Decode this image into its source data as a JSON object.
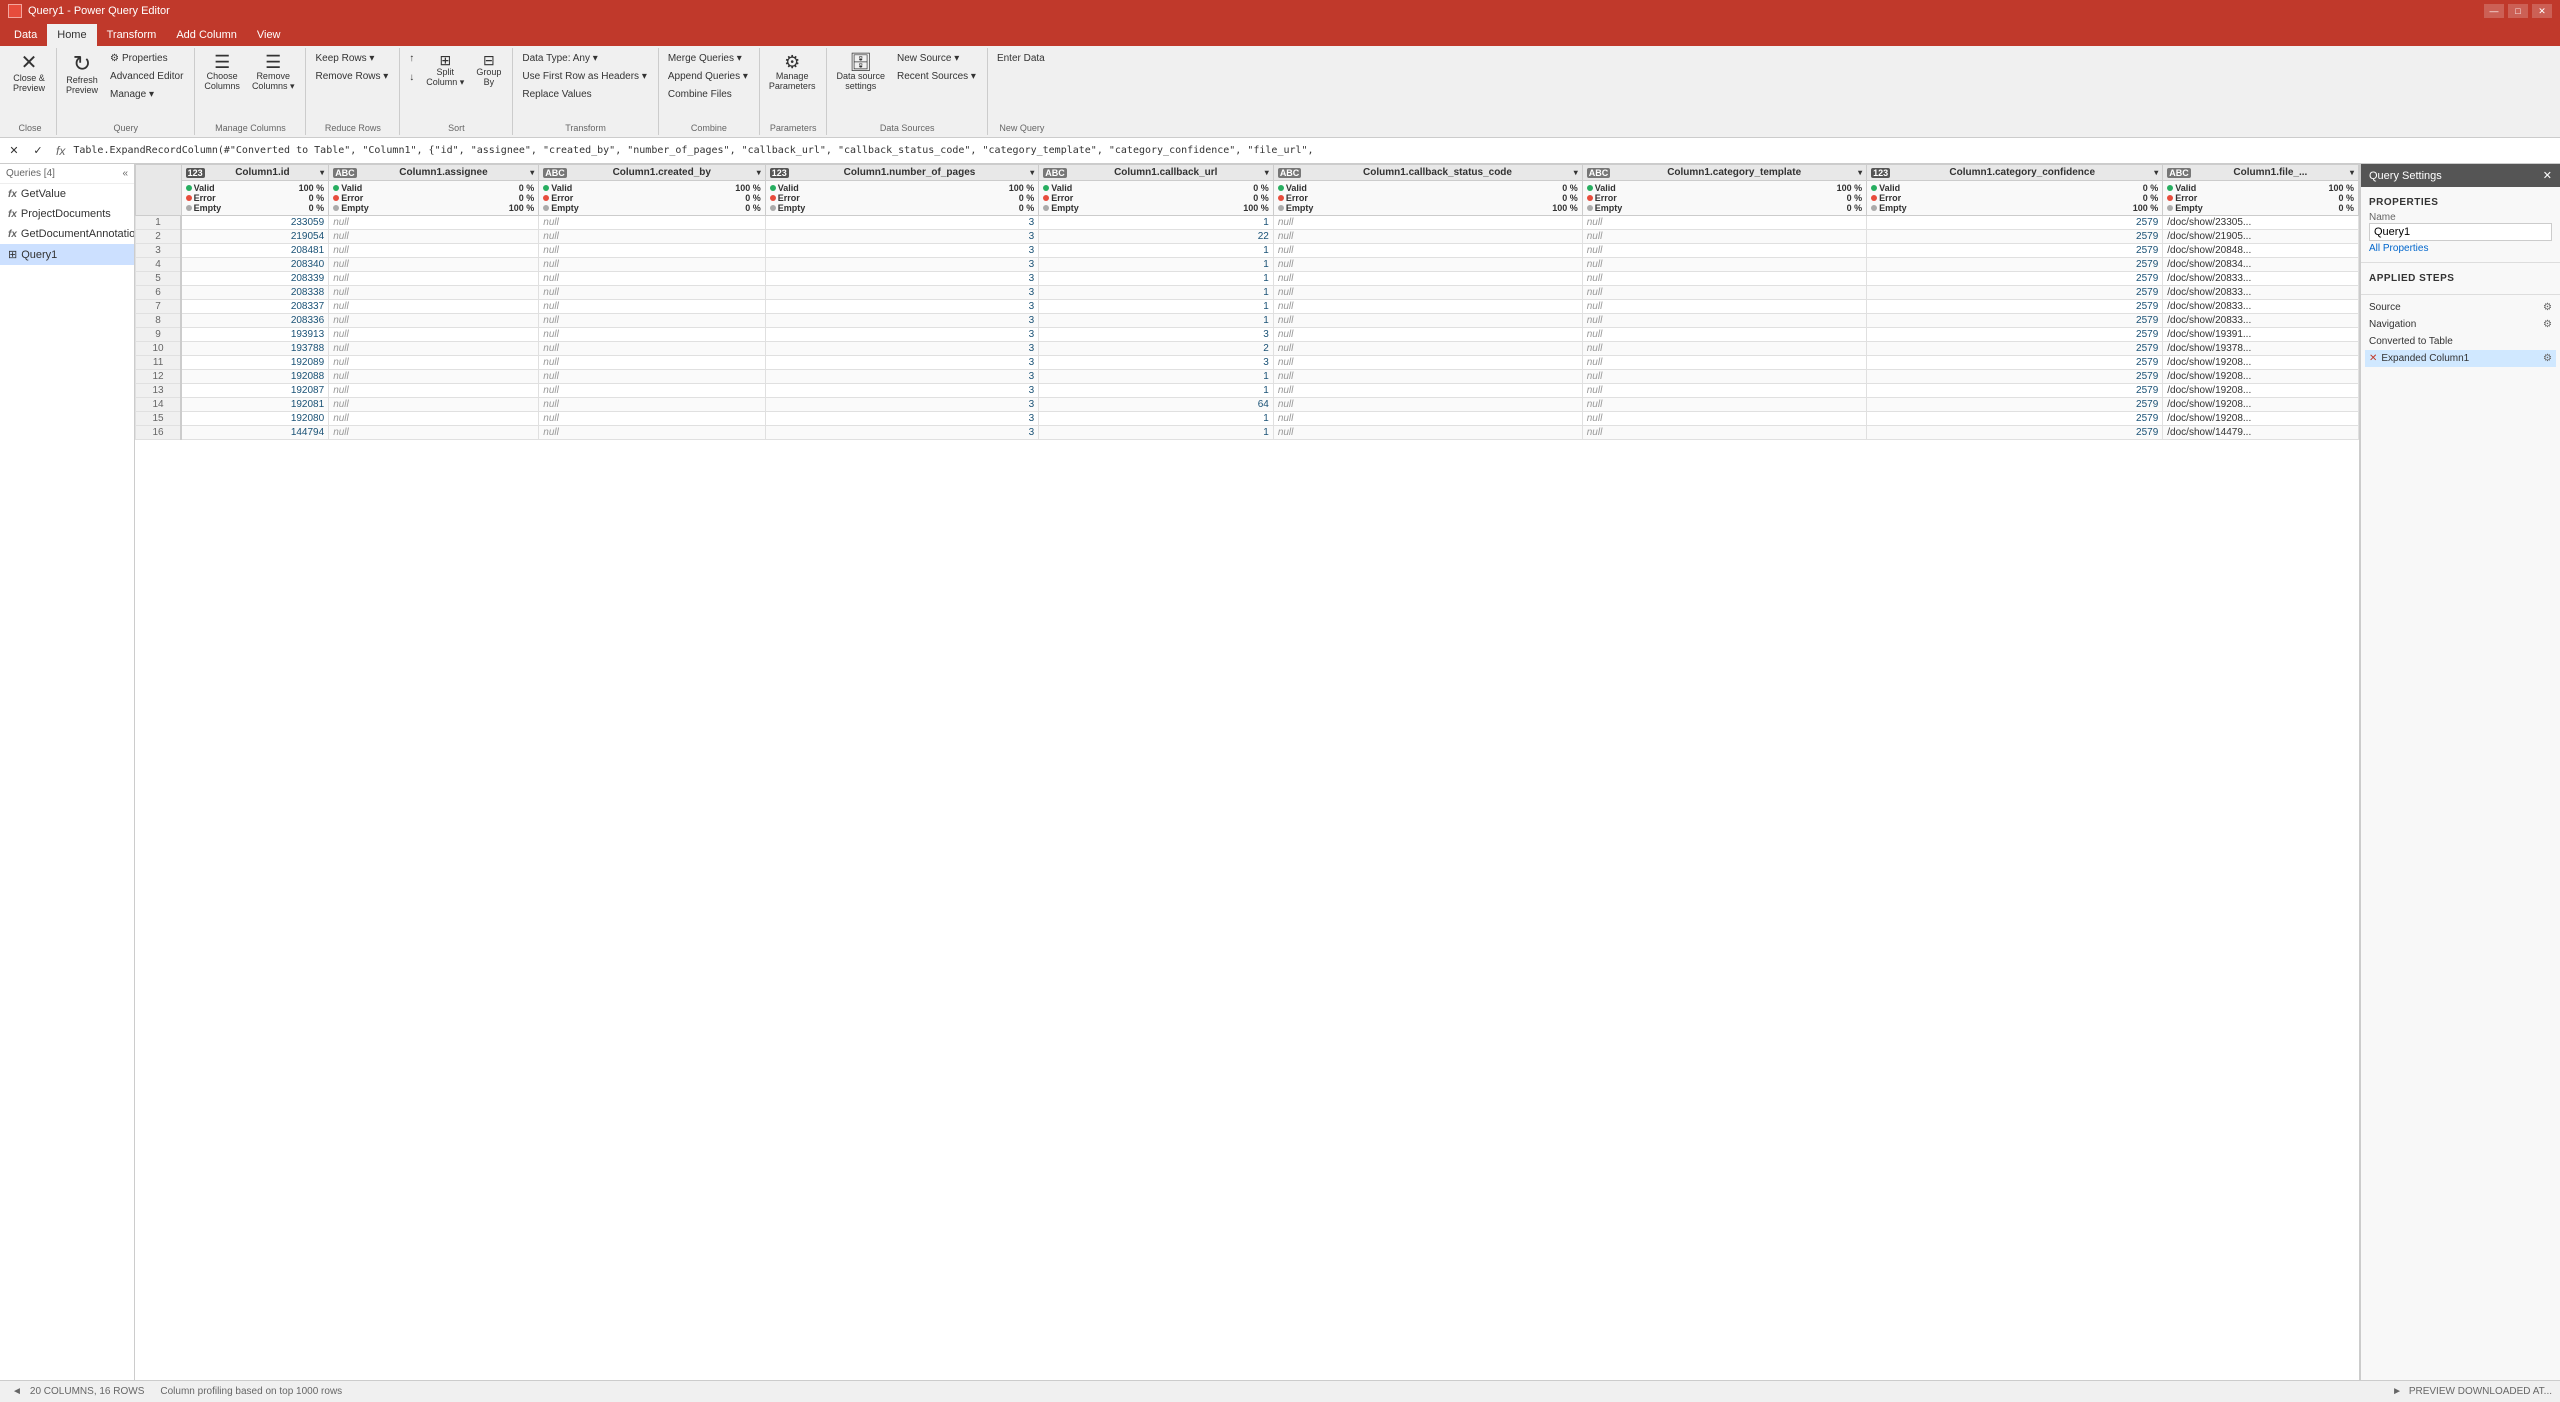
{
  "titlebar": {
    "icon": "⚡",
    "title": "Query1 - Power Query Editor",
    "controls": [
      "—",
      "□",
      "✕"
    ]
  },
  "tabs": [
    {
      "id": "data",
      "label": "Data"
    },
    {
      "id": "home",
      "label": "Home",
      "active": true
    },
    {
      "id": "transform",
      "label": "Transform"
    },
    {
      "id": "add_column",
      "label": "Add Column"
    },
    {
      "id": "view",
      "label": "View"
    }
  ],
  "ribbon": {
    "groups": [
      {
        "label": "Close",
        "items": [
          {
            "type": "big",
            "icon": "✕",
            "label": "Close &\nPreview",
            "name": "close-preview"
          }
        ]
      },
      {
        "label": "Query",
        "items": [
          {
            "type": "big",
            "icon": "↻",
            "label": "Refresh\nPreview",
            "name": "refresh-preview"
          },
          {
            "type": "col",
            "items": [
              {
                "label": "Properties",
                "icon": "⚙",
                "name": "properties"
              },
              {
                "label": "Advanced Editor",
                "name": "advanced-editor"
              },
              {
                "label": "Manage ▾",
                "name": "manage"
              }
            ]
          }
        ]
      },
      {
        "label": "Manage Columns",
        "items": [
          {
            "type": "big",
            "icon": "☰+",
            "label": "Choose\nColumns",
            "name": "choose-columns"
          },
          {
            "type": "big",
            "icon": "☰-",
            "label": "Remove\nColumns ▾",
            "name": "remove-columns"
          }
        ]
      },
      {
        "label": "Reduce Rows",
        "items": [
          {
            "type": "col",
            "items": [
              {
                "label": "Keep\nRows ▾",
                "name": "keep-rows"
              },
              {
                "label": "Remove\nRows ▾",
                "name": "remove-rows"
              }
            ]
          }
        ]
      },
      {
        "label": "Sort",
        "items": [
          {
            "type": "col",
            "items": [
              {
                "label": "↑",
                "name": "sort-asc"
              },
              {
                "label": "↓",
                "name": "sort-desc"
              },
              {
                "label": "Split\nColumn ▾",
                "name": "split-column"
              },
              {
                "label": "Group\nBy",
                "name": "group-by"
              }
            ]
          }
        ]
      },
      {
        "label": "Transform",
        "items": [
          {
            "type": "col",
            "items": [
              {
                "label": "Data Type: Any ▾",
                "name": "data-type"
              },
              {
                "label": "Use First Row as Headers ▾",
                "name": "use-first-row"
              },
              {
                "label": "Replace Values",
                "name": "replace-values"
              }
            ]
          }
        ]
      },
      {
        "label": "Combine",
        "items": [
          {
            "type": "col",
            "items": [
              {
                "label": "Merge Queries ▾",
                "name": "merge-queries"
              },
              {
                "label": "Append Queries ▾",
                "name": "append-queries"
              },
              {
                "label": "Combine Files",
                "name": "combine-files"
              }
            ]
          }
        ]
      },
      {
        "label": "Parameters",
        "items": [
          {
            "type": "big",
            "icon": "⚙",
            "label": "Manage\nParameters",
            "name": "manage-parameters"
          }
        ]
      },
      {
        "label": "Data Sources",
        "items": [
          {
            "type": "big",
            "icon": "🗄",
            "label": "Data source\nsettings",
            "name": "data-source-settings"
          },
          {
            "type": "col",
            "items": [
              {
                "label": "▲ New Source ▾",
                "name": "new-source"
              },
              {
                "label": "Recent Sources ▾",
                "name": "recent-sources"
              }
            ]
          }
        ]
      },
      {
        "label": "New Query",
        "items": [
          {
            "type": "col",
            "items": [
              {
                "label": "Enter Data",
                "name": "enter-data"
              }
            ]
          }
        ]
      }
    ]
  },
  "formula_bar": {
    "cancel": "✕",
    "confirm": "✓",
    "fx": "fx",
    "formula": "Table.ExpandRecordColumn(#\"Converted to Table\", \"Column1\", {\"id\", \"assignee\", \"created_by\", \"number_of_pages\", \"callback_url\", \"callback_status_code\", \"category_template\", \"category_confidence\", \"file_url\","
  },
  "queries": {
    "header": "Queries [4]",
    "items": [
      {
        "name": "GetValue",
        "type": "fx",
        "icon": "fx"
      },
      {
        "name": "ProjectDocuments",
        "type": "fx",
        "icon": "fx"
      },
      {
        "name": "GetDocumentAnnotations",
        "type": "fx",
        "icon": "fx"
      },
      {
        "name": "Query1",
        "type": "query",
        "icon": "⊞",
        "selected": true
      }
    ]
  },
  "columns": [
    {
      "type": "123",
      "name": "Column1.id",
      "valid": "Valid",
      "valid_pct": "100 %",
      "error": "Error",
      "error_pct": "0 %",
      "empty": "Empty",
      "empty_pct": "0 %"
    },
    {
      "type": "ABC",
      "name": "Column1.assignee",
      "valid": "Valid",
      "valid_pct": "0 %",
      "error": "Error",
      "error_pct": "0 %",
      "empty": "Empty",
      "empty_pct": "100 %"
    },
    {
      "type": "ABC",
      "name": "Column1.created_by",
      "valid": "Valid",
      "valid_pct": "100 %",
      "error": "Error",
      "error_pct": "0 %",
      "empty": "Empty",
      "empty_pct": "0 %"
    },
    {
      "type": "123",
      "name": "Column1.number_of_pages",
      "valid": "Valid",
      "valid_pct": "100 %",
      "error": "Error",
      "error_pct": "0 %",
      "empty": "Empty",
      "empty_pct": "0 %"
    },
    {
      "type": "ABC",
      "name": "Column1.callback_url",
      "valid": "Valid",
      "valid_pct": "0 %",
      "error": "Error",
      "error_pct": "0 %",
      "empty": "Empty",
      "empty_pct": "100 %"
    },
    {
      "type": "ABC",
      "name": "Column1.callback_status_code",
      "valid": "Valid",
      "valid_pct": "0 %",
      "error": "Error",
      "error_pct": "0 %",
      "empty": "Empty",
      "empty_pct": "100 %"
    },
    {
      "type": "ABC",
      "name": "Column1.category_template",
      "valid": "Valid",
      "valid_pct": "100 %",
      "error": "Error",
      "error_pct": "0 %",
      "empty": "Empty",
      "empty_pct": "0 %"
    },
    {
      "type": "123",
      "name": "Column1.category_confidence",
      "valid": "Valid",
      "valid_pct": "0 %",
      "error": "Error",
      "error_pct": "0 %",
      "empty": "Empty",
      "empty_pct": "100 %"
    },
    {
      "type": "ABC",
      "name": "Column1.file_url (trunc)",
      "valid": "Valid",
      "valid_pct": "100 %",
      "error": "Error",
      "error_pct": "0 %",
      "empty": "Empty",
      "empty_pct": "0 %"
    }
  ],
  "rows": [
    [
      1,
      233059,
      "null",
      "null",
      3,
      1,
      "null",
      "null",
      2579,
      "/doc/show/23305..."
    ],
    [
      2,
      219054,
      "null",
      "null",
      3,
      22,
      "null",
      "null",
      2579,
      "/doc/show/21905..."
    ],
    [
      3,
      208481,
      "null",
      "null",
      3,
      1,
      "null",
      "null",
      2579,
      "/doc/show/20848..."
    ],
    [
      4,
      208340,
      "null",
      "null",
      3,
      1,
      "null",
      "null",
      2579,
      "/doc/show/20834..."
    ],
    [
      5,
      208339,
      "null",
      "null",
      3,
      1,
      "null",
      "null",
      2579,
      "/doc/show/20833..."
    ],
    [
      6,
      208338,
      "null",
      "null",
      3,
      1,
      "null",
      "null",
      2579,
      "/doc/show/20833..."
    ],
    [
      7,
      208337,
      "null",
      "null",
      3,
      1,
      "null",
      "null",
      2579,
      "/doc/show/20833..."
    ],
    [
      8,
      208336,
      "null",
      "null",
      3,
      1,
      "null",
      "null",
      2579,
      "/doc/show/20833..."
    ],
    [
      9,
      193913,
      "null",
      "null",
      3,
      3,
      "null",
      "null",
      2579,
      "/doc/show/19391..."
    ],
    [
      10,
      193788,
      "null",
      "null",
      3,
      2,
      "null",
      "null",
      2579,
      "/doc/show/19378..."
    ],
    [
      11,
      192089,
      "null",
      "null",
      3,
      3,
      "null",
      "null",
      2579,
      "/doc/show/19208..."
    ],
    [
      12,
      192088,
      "null",
      "null",
      3,
      1,
      "null",
      "null",
      2579,
      "/doc/show/19208..."
    ],
    [
      13,
      192087,
      "null",
      "null",
      3,
      1,
      "null",
      "null",
      2579,
      "/doc/show/19208..."
    ],
    [
      14,
      192081,
      "null",
      "null",
      3,
      64,
      "null",
      "null",
      2579,
      "/doc/show/19208..."
    ],
    [
      15,
      192080,
      "null",
      "null",
      3,
      1,
      "null",
      "null",
      2579,
      "/doc/show/19208..."
    ],
    [
      16,
      144794,
      "null",
      "null",
      3,
      1,
      "null",
      "null",
      2579,
      "/doc/show/14479..."
    ]
  ],
  "query_settings": {
    "title": "Query Settings",
    "close": "✕",
    "properties_label": "PROPERTIES",
    "name_label": "Name",
    "name_value": "Query1",
    "all_properties": "All Properties",
    "applied_steps_label": "APPLIED STEPS",
    "steps": [
      {
        "name": "Source",
        "active": false,
        "has_gear": true
      },
      {
        "name": "Navigation",
        "active": false,
        "has_gear": true
      },
      {
        "name": "Converted to Table",
        "active": false,
        "has_gear": false
      },
      {
        "name": "Expanded Column1",
        "active": true,
        "has_gear": true
      }
    ]
  },
  "status": {
    "columns": "20 COLUMNS, 16 ROWS",
    "profiling": "Column profiling based on top 1000 rows",
    "preview": "PREVIEW DOWNLOADED AT..."
  }
}
